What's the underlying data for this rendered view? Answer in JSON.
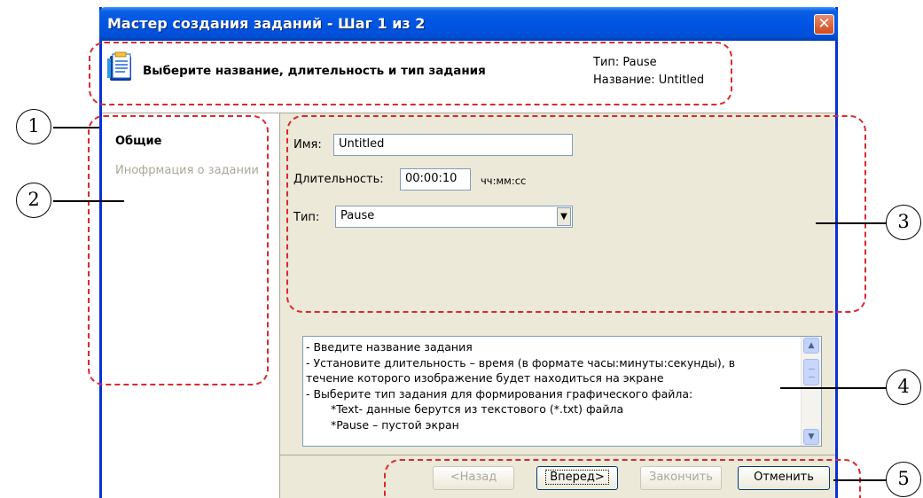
{
  "window": {
    "title": "Мастер создания заданий - Шаг 1 из 2",
    "close_glyph": "✕"
  },
  "header": {
    "title": "Выберите название, длительность и тип задания",
    "type_summary": "Тип: Pause",
    "name_summary": "Название: Untitled",
    "icon": "wizard-document-icon"
  },
  "sidebar": {
    "items": [
      {
        "label": "Общие",
        "active": true
      },
      {
        "label": "Инофрмация о задании",
        "active": false
      }
    ]
  },
  "form": {
    "name_label": "Имя:",
    "name_value": "Untitled",
    "duration_label": "Длительность:",
    "duration_value": "00:00:10",
    "duration_format": "чч:мм:сс",
    "type_label": "Тип:",
    "type_value": "Pause"
  },
  "info": {
    "lines": [
      "- Введите название задания",
      "- Установите длительность – время (в формате часы:минуты:секунды), в",
      "течение которого изображение будет находиться на экране",
      "- Выберите тип задания для формирования графического файла:",
      "*Text- данные берутся из текстового (*.txt) файла",
      "*Pause – пустой экран"
    ]
  },
  "buttons": {
    "back": "<Назад",
    "next": "Вперед>",
    "finish": "Закончить",
    "cancel": "Отменить"
  },
  "callouts": [
    "1",
    "2",
    "3",
    "4",
    "5"
  ],
  "colors": {
    "annotation": "#dc2830",
    "titlebar": "#0054e3",
    "dialog_bg": "#ece9d8"
  }
}
